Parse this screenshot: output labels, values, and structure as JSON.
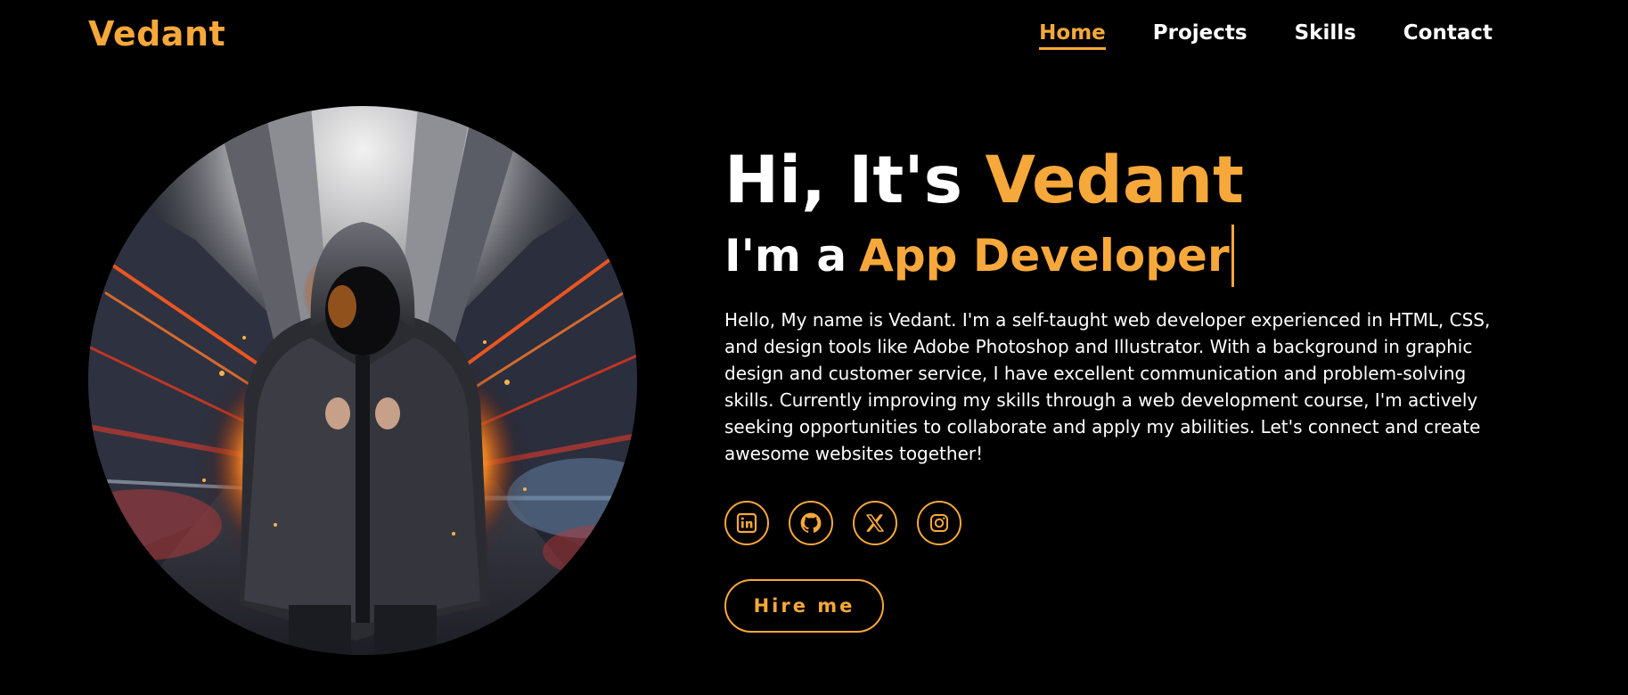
{
  "brand": {
    "logo": "Vedant",
    "accent_color": "#f7a83a",
    "background_color": "#000000"
  },
  "nav": {
    "items": [
      {
        "label": "Home",
        "active": true
      },
      {
        "label": "Projects",
        "active": false
      },
      {
        "label": "Skills",
        "active": false
      },
      {
        "label": "Contact",
        "active": false
      }
    ]
  },
  "hero": {
    "greeting_prefix": "Hi, It's",
    "greeting_name": "Vedant",
    "role_prefix": "I'm a",
    "role_title": "App Developer",
    "bio": "Hello, My name is Vedant. I'm a self-taught web developer experienced in HTML, CSS, and design tools like Adobe Photoshop and Illustrator. With a background in graphic design and customer service, I have excellent communication and problem-solving skills. Currently improving my skills through a web development course, I'm actively seeking opportunities to collaborate and apply my abilities. Let's connect and create awesome websites together!",
    "image_icon": "hooded-figure-fire-street-image",
    "hire_label": "Hire me"
  },
  "socials": [
    {
      "icon": "linkedin-icon"
    },
    {
      "icon": "github-icon"
    },
    {
      "icon": "x-twitter-icon"
    },
    {
      "icon": "instagram-icon"
    }
  ]
}
